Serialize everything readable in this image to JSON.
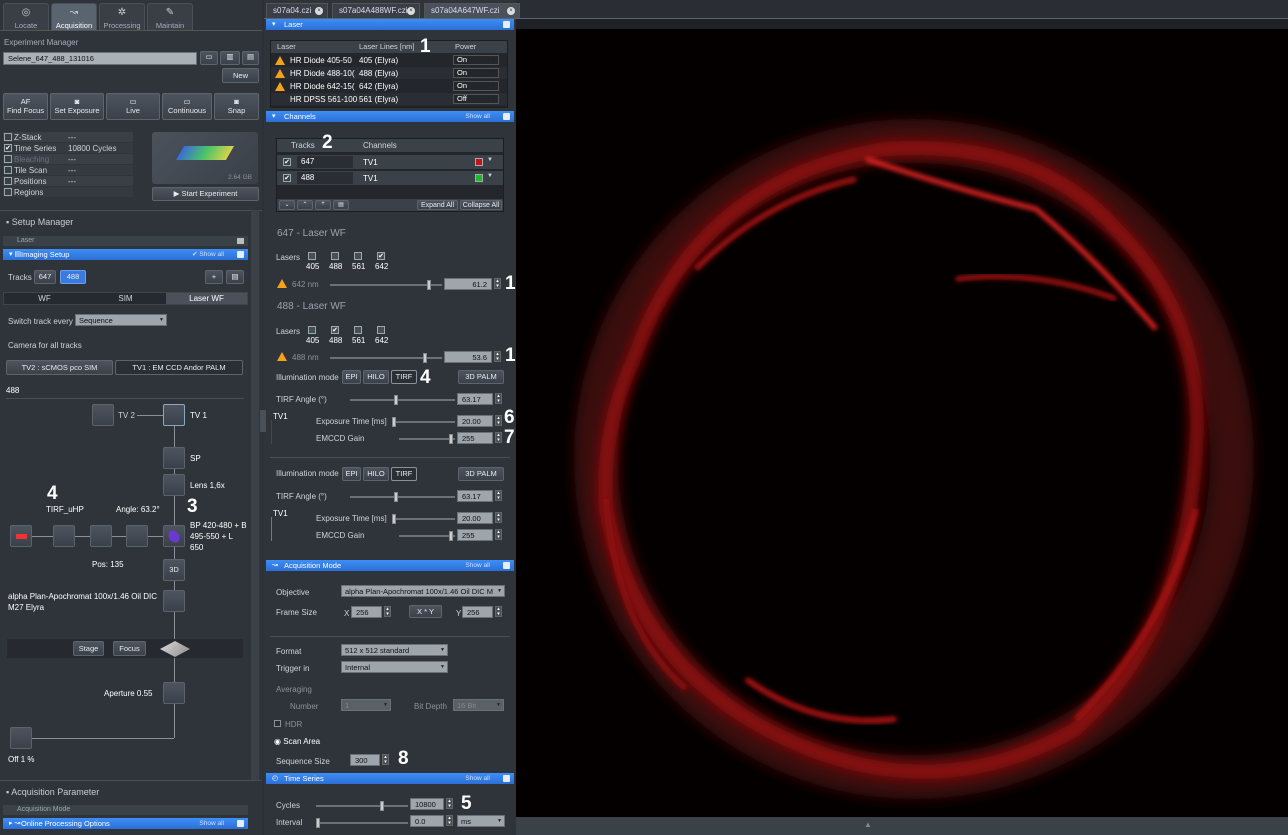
{
  "top_tabs": [
    {
      "label": "Locate",
      "icon": "crosshair-icon"
    },
    {
      "label": "Acquisition",
      "icon": "acquisition-icon"
    },
    {
      "label": "Processing",
      "icon": "gear-icon"
    },
    {
      "label": "Maintain",
      "icon": "wrench-icon"
    }
  ],
  "experiment": {
    "section_label": "Experiment Manager",
    "name": "Selene_647_488_131016",
    "new_label": "New"
  },
  "toolbar": {
    "find_focus_top": "AF",
    "find_focus": "Find Focus",
    "set_exposure": "Set Exposure",
    "live": "Live",
    "continuous": "Continuous",
    "snap": "Snap"
  },
  "options": [
    {
      "label": "Z-Stack",
      "value": "---",
      "checked": false
    },
    {
      "label": "Time Series",
      "value": "10800 Cycles",
      "checked": true
    },
    {
      "label": "Bleaching",
      "value": "---",
      "checked": false,
      "disabled": true
    },
    {
      "label": "Tile Scan",
      "value": "---",
      "checked": false
    },
    {
      "label": "Positions",
      "value": "---",
      "checked": false
    },
    {
      "label": "Regions",
      "value": "",
      "checked": false
    }
  ],
  "storage_label": "2.64 GB",
  "start_experiment": "Start Experiment",
  "setup_manager": {
    "title": "Setup Manager",
    "laser_label": "Laser",
    "imaging_setup": "Imaging Setup",
    "show_all": "Show all",
    "tracks_label": "Tracks",
    "track1": "647",
    "track2": "488",
    "wf": "WF",
    "sim": "SIM",
    "laser_wf": "Laser WF",
    "switch_label": "Switch track every",
    "switch_value": "Sequence",
    "camera_label": "Camera for all tracks",
    "cam1": "TV2 : sCMOS pco SIM",
    "cam2": "TV1 : EM CCD Andor PALM",
    "track_name": "488"
  },
  "lightpath": {
    "tv2": "TV 2",
    "tv1": "TV 1",
    "sp": "SP",
    "lens": "Lens 1,6x",
    "tirf": "TIRF_uHP",
    "angle": "Angle: 63.2°",
    "filter1": "BP 420-480 + B",
    "filter2": "495-550   +   L",
    "filter3": "650",
    "pos": "Pos: 135",
    "btn3d": "3D",
    "objective": "alpha Plan-Apochromat 100x/1.46 Oil DIC",
    "objective2": "M27 Elyra",
    "stage": "Stage",
    "focus": "Focus",
    "aperture": "Aperture  0.55",
    "lamp": "Off  1 %"
  },
  "acq_param": {
    "title": "Acquisition Parameter",
    "acq_mode": "Acquisition Mode",
    "online": "Online Processing Options",
    "show_all": "Show all"
  },
  "file_tabs": [
    {
      "label": "s07a04.czi"
    },
    {
      "label": "s07a04A488WF.czi"
    },
    {
      "label": "s07a04A647WF.czi"
    }
  ],
  "laser_panel": {
    "title": "Laser",
    "col1": "Laser",
    "col2": "Laser Lines [nm]",
    "col3": "Power",
    "rows": [
      {
        "name": "HR Diode 405-50",
        "lines": "405 (Elyra)",
        "power": "On",
        "warn": true
      },
      {
        "name": "HR Diode 488-10(",
        "lines": "488 (Elyra)",
        "power": "On",
        "warn": true
      },
      {
        "name": "HR Diode 642-15(",
        "lines": "642 (Elyra)",
        "power": "On",
        "warn": true
      },
      {
        "name": "HR DPSS 561-100",
        "lines": "561 (Elyra)",
        "power": "Off",
        "warn": false
      }
    ]
  },
  "channels": {
    "title": "Channels",
    "show_all": "Show all",
    "col_tracks": "Tracks",
    "col_channels": "Channels",
    "rows": [
      {
        "track": "647",
        "channel": "TV1",
        "color": "#c0141a"
      },
      {
        "track": "488",
        "channel": "TV1",
        "color": "#18b82a"
      }
    ],
    "expand_all": "Expand All",
    "collapse_all": "Collapse All"
  },
  "track647": {
    "title": "647 - Laser WF",
    "lasers_label": "Lasers",
    "laser_opts": [
      "405",
      "488",
      "561",
      "642"
    ],
    "checked": "642",
    "slider_label": "642 nm",
    "value": "61.2",
    "illum_label": "Illumination mode",
    "epi": "EPI",
    "hilo": "HILO",
    "tirf": "TIRF",
    "palm": "3D PALM",
    "tirf_angle_label": "TIRF Angle (°)",
    "tirf_angle": "63.17",
    "tv": "TV1",
    "exposure_label": "Exposure Time [ms]",
    "exposure": "20.00",
    "gain_label": "EMCCD Gain",
    "gain": "255"
  },
  "track488": {
    "title": "488 - Laser WF",
    "lasers_label": "Lasers",
    "laser_opts": [
      "405",
      "488",
      "561",
      "642"
    ],
    "checked": "488",
    "slider_label": "488 nm",
    "value": "53.6",
    "illum_label": "Illumination mode",
    "epi": "EPI",
    "hilo": "HILO",
    "tirf": "TIRF",
    "palm": "3D PALM",
    "tirf_angle_label": "TIRF Angle (°)",
    "tirf_angle": "63.17",
    "tv": "TV1",
    "exposure_label": "Exposure Time [ms]",
    "exposure": "20.00",
    "gain_label": "EMCCD Gain",
    "gain": "255"
  },
  "acq_mode": {
    "title": "Acquisition Mode",
    "show_all": "Show all",
    "objective_label": "Objective",
    "objective": "alpha Plan-Apochromat 100x/1.46 Oil DIC M",
    "frame_label": "Frame Size",
    "x_label": "X",
    "x": "256",
    "xy": "X * Y",
    "y_label": "Y",
    "y": "256",
    "format_label": "Format",
    "format": "512 x 512 standard",
    "trigger_label": "Trigger in",
    "trigger": "Internal",
    "averaging": "Averaging",
    "number_label": "Number",
    "number": "1",
    "bitdepth_label": "Bit Depth",
    "bitdepth": "16 Bit",
    "hdr": "HDR",
    "scan_area": "Scan Area",
    "seq_label": "Sequence Size",
    "seq": "300"
  },
  "time_series": {
    "title": "Time Series",
    "show_all": "Show all",
    "cycles_label": "Cycles",
    "cycles": "10800",
    "interval_label": "Interval",
    "interval": "0.0",
    "unit": "ms"
  },
  "annotations": {
    "n1a": "1",
    "n1b": "1",
    "n1c": "1",
    "n2": "2",
    "n3": "3",
    "n4a": "4",
    "n4b": "4",
    "n5": "5",
    "n6": "6",
    "n7": "7",
    "n8": "8"
  }
}
